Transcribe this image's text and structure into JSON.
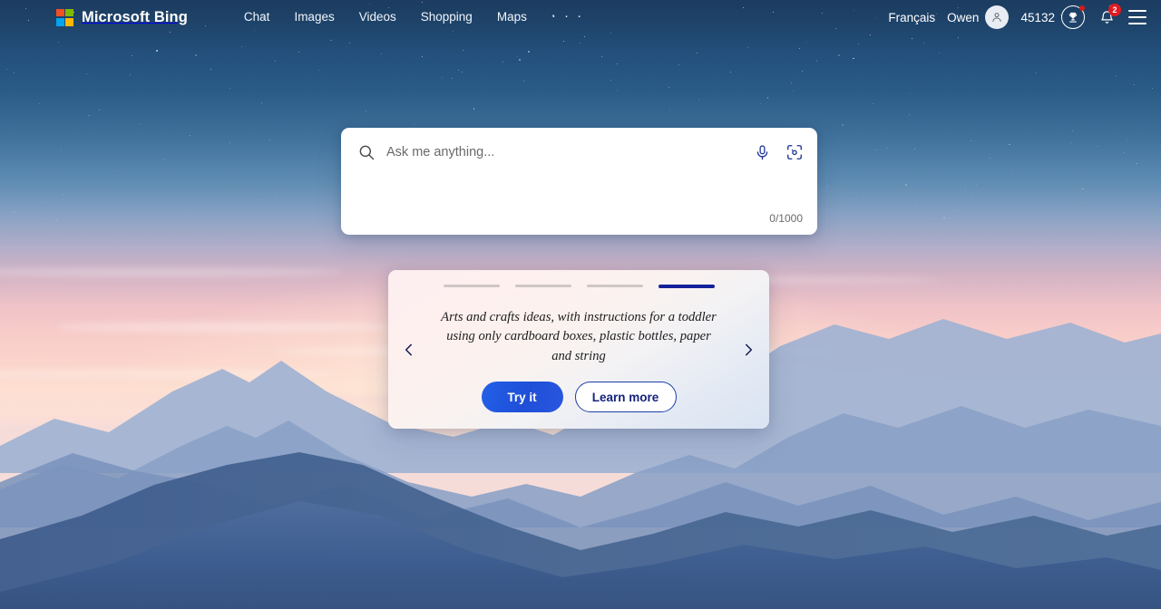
{
  "header": {
    "brand": "Microsoft Bing",
    "logo_icon": "microsoft-logo-icon",
    "nav": [
      {
        "label": "Chat"
      },
      {
        "label": "Images"
      },
      {
        "label": "Videos"
      },
      {
        "label": "Shopping"
      },
      {
        "label": "Maps"
      }
    ],
    "more_label": "· · ·",
    "language": "Français",
    "user_name": "Owen",
    "avatar_icon": "person-avatar-icon",
    "rewards_points": "45132",
    "rewards_icon": "trophy-rewards-icon",
    "notifications_icon": "bell-icon",
    "notifications_count": "2",
    "menu_icon": "hamburger-menu-icon"
  },
  "search": {
    "icon": "search-icon",
    "placeholder": "Ask me anything...",
    "value": "",
    "mic_icon": "microphone-icon",
    "visual_search_icon": "visual-search-camera-icon",
    "counter": "0/1000"
  },
  "carousel": {
    "prev_icon": "chevron-left-icon",
    "next_icon": "chevron-right-icon",
    "slide_count": 4,
    "active_slide": 4,
    "prompt": "Arts and crafts ideas, with instructions for a toddler using only cardboard boxes, plastic bottles, paper and string",
    "primary_button": "Try it",
    "secondary_button": "Learn more"
  },
  "colors": {
    "accent_blue": "#2360e8",
    "active_bar": "#14219b",
    "badge_red": "#e11a22",
    "outline_blue": "#1b3fa8"
  }
}
